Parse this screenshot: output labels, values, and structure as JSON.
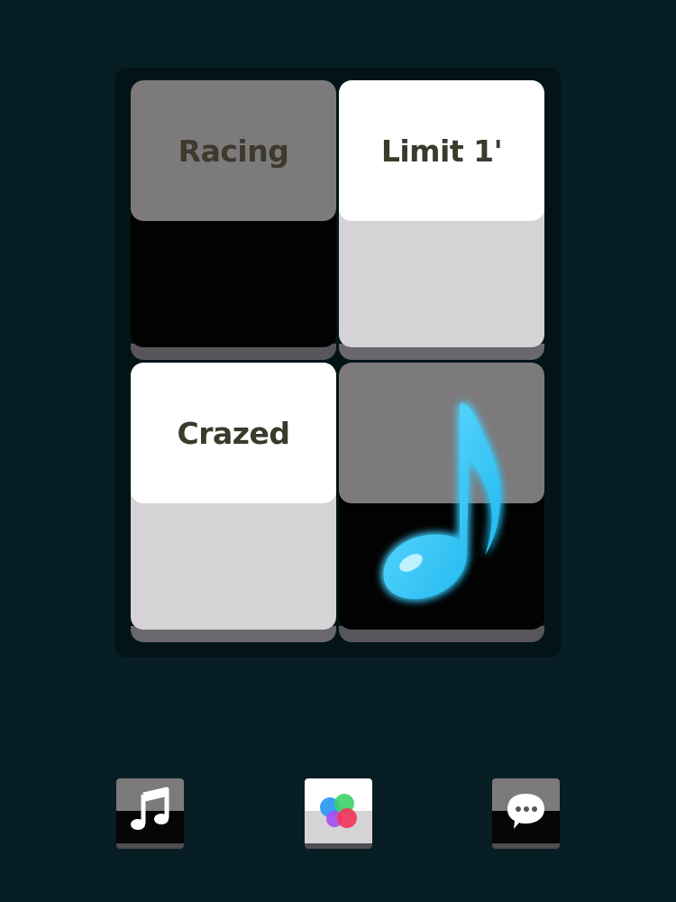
{
  "modes": [
    {
      "label": "Racing"
    },
    {
      "label": "Limit 1'"
    },
    {
      "label": "Crazed"
    }
  ],
  "colors": {
    "background": "#061e24",
    "note_glow": "#2ec8ff",
    "label_text": "#3b3a2c"
  },
  "icons": {
    "logo": "music-note-icon",
    "buttons": [
      "music-icon",
      "game-center-icon",
      "chat-bubble-icon"
    ]
  }
}
